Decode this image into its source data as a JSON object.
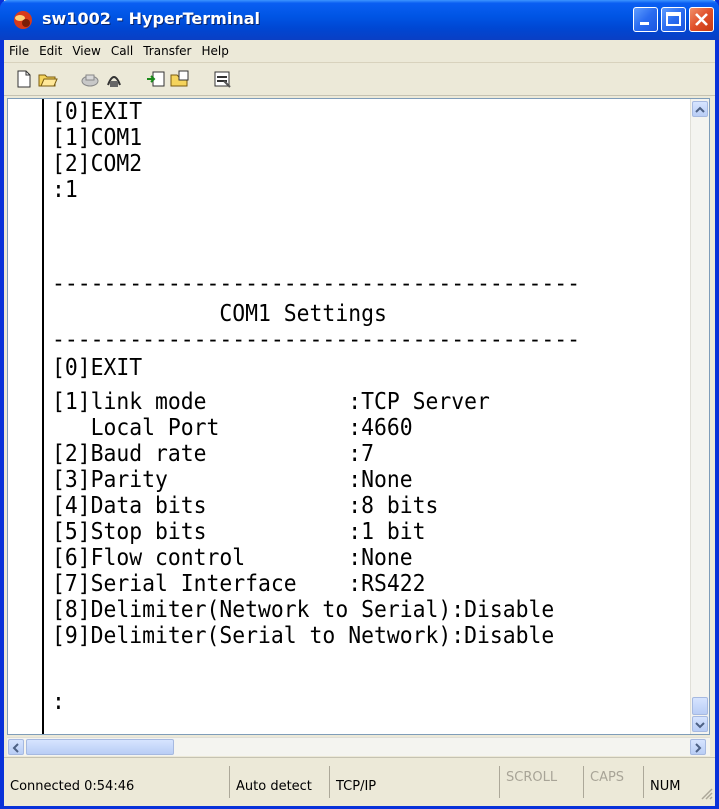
{
  "window": {
    "title": "sw1002 - HyperTerminal"
  },
  "menu": [
    "File",
    "Edit",
    "View",
    "Call",
    "Transfer",
    "Help"
  ],
  "toolbar": [
    "new-icon",
    "open-icon",
    "disconnect-icon",
    "dial-icon",
    "send-icon",
    "receive-icon",
    "properties-icon"
  ],
  "terminal": {
    "lines": [
      "[0]EXIT",
      "[1]COM1",
      "[2]COM2",
      ":1",
      "",
      "-----------------------------------------",
      "             COM1 Settings",
      "-----------------------------------------",
      "[0]EXIT",
      "[1]link mode           :TCP Server",
      "   Local Port          :4660",
      "[2]Baud rate           :7",
      "[3]Parity              :None",
      "[4]Data bits           :8 bits",
      "[5]Stop bits           :1 bit",
      "[6]Flow control        :None",
      "[7]Serial Interface    :RS422",
      "[8]Delimiter(Network to Serial):Disable",
      "[9]Delimiter(Serial to Network):Disable",
      "",
      ":"
    ]
  },
  "status": {
    "connected": "Connected 0:54:46",
    "detect": "Auto detect",
    "protocol": "TCP/IP",
    "scroll": "SCROLL",
    "caps": "CAPS",
    "num": "NUM"
  }
}
